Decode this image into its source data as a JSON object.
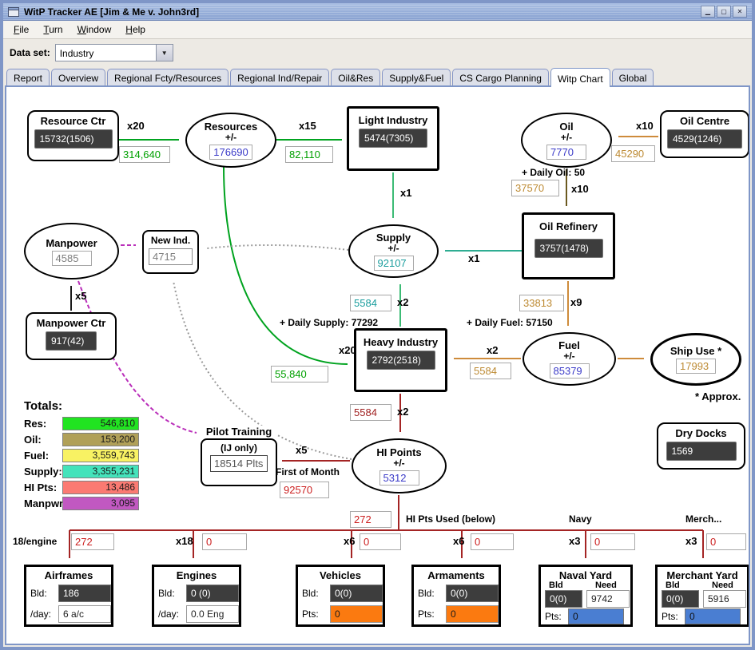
{
  "window": {
    "title": "WitP Tracker AE [Jim & Me v. John3rd]",
    "controls": {
      "minimize": "▁",
      "maximize": "▢",
      "close": "✕"
    }
  },
  "menu": {
    "items": [
      {
        "label": "File"
      },
      {
        "label": "Turn"
      },
      {
        "label": "Window"
      },
      {
        "label": "Help"
      }
    ]
  },
  "dataset": {
    "label": "Data set:",
    "value": "Industry"
  },
  "tabs": [
    {
      "label": "Report"
    },
    {
      "label": "Overview"
    },
    {
      "label": "Regional Fcty/Resources"
    },
    {
      "label": "Regional Ind/Repair"
    },
    {
      "label": "Oil&Res"
    },
    {
      "label": "Supply&Fuel"
    },
    {
      "label": "CS Cargo Planning"
    },
    {
      "label": "Witp Chart",
      "selected": true
    },
    {
      "label": "Global"
    }
  ],
  "nodes": {
    "resource_ctr": {
      "title": "Resource Ctr",
      "value": "15732(1506)"
    },
    "resources": {
      "title": "Resources",
      "pm": "+/-",
      "value": "176690"
    },
    "light_industry": {
      "title": "Light Industry",
      "value": "5474(7305)"
    },
    "oil": {
      "title": "Oil",
      "pm": "+/-",
      "value": "7770"
    },
    "oil_centre": {
      "title": "Oil Centre",
      "value": "4529(1246)"
    },
    "oil_refinery": {
      "title": "Oil Refinery",
      "value": "3757(1478)"
    },
    "supply": {
      "title": "Supply",
      "pm": "+/-",
      "value": "92107"
    },
    "manpower": {
      "title": "Manpower",
      "value": "4585"
    },
    "new_ind": {
      "title": "New Ind.",
      "value": "4715"
    },
    "manpower_ctr": {
      "title": "Manpower Ctr",
      "value": "917(42)"
    },
    "heavy_industry": {
      "title": "Heavy Industry",
      "value": "2792(2518)"
    },
    "fuel": {
      "title": "Fuel",
      "pm": "+/-",
      "value": "85379"
    },
    "ship_use": {
      "title": "Ship Use *",
      "value": "17993"
    },
    "pilot_training": {
      "title": "Pilot Training",
      "sub": "(IJ only)",
      "value": "18514 Plts"
    },
    "hi_points": {
      "title": "HI Points",
      "pm": "+/-",
      "value": "5312"
    },
    "dry_docks": {
      "title": "Dry Docks",
      "value": "1569"
    }
  },
  "flows": {
    "rc_to_resources": {
      "mult": "x20",
      "amount": "314,640"
    },
    "resources_to_light": {
      "mult": "x15",
      "amount": "82,110"
    },
    "resources_to_heavy": {
      "mult": "x20",
      "amount": "55,840"
    },
    "light_to_supply": {
      "mult": "x1"
    },
    "refinery_to_supply": {
      "mult": "x1"
    },
    "heavy_to_supply": {
      "mult": "x2",
      "amount": "5584"
    },
    "oilcentre_to_oil": {
      "mult": "x10",
      "amount": "45290"
    },
    "oil_to_refinery": {
      "mult": "x10",
      "amount": "37570"
    },
    "refinery_to_fuel": {
      "mult": "x9",
      "amount": "33813"
    },
    "fuel_to_heavy": {
      "mult": "x2",
      "amount": "5584"
    },
    "heavy_to_hipts": {
      "mult": "x2",
      "amount": "5584"
    },
    "hipts_to_pilot": {
      "mult": "x5"
    },
    "manpowerctr_to_manpower": {
      "mult": "x5"
    },
    "hipts_down": {
      "amount": "272"
    }
  },
  "annotations": {
    "daily_oil": "+ Daily Oil: 50",
    "daily_supply": "+ Daily Supply: 77292",
    "daily_fuel": "+ Daily Fuel: 57150",
    "approx": "* Approx.",
    "first_of_month": "First of Month",
    "first_of_month_amount": "92570",
    "hi_pts_used": "HI Pts Used (below)",
    "navy": "Navy",
    "merch": "Merch..."
  },
  "totals": {
    "heading": "Totals:",
    "rows": [
      {
        "label": "Res:",
        "value": "546,810",
        "color": "#21e421"
      },
      {
        "label": "Oil:",
        "value": "153,200",
        "color": "#b0a058"
      },
      {
        "label": "Fuel:",
        "value": "3,559,743",
        "color": "#f8f263"
      },
      {
        "label": "Supply:",
        "value": "3,355,231",
        "color": "#44e3bb"
      },
      {
        "label": "HI Pts:",
        "value": "13,486",
        "color": "#fb7a72"
      },
      {
        "label": "Manpwr:",
        "value": "3,095",
        "color": "#c158c1"
      }
    ]
  },
  "bottom_row": [
    {
      "label": "18/engine",
      "value": "272"
    },
    {
      "label": "x18",
      "value": "0"
    },
    {
      "label": "x6",
      "value": "0"
    },
    {
      "label": "x6",
      "value": "0"
    },
    {
      "label": "x3",
      "value": "0"
    },
    {
      "label": "x3",
      "value": "0"
    }
  ],
  "factories": [
    {
      "title": "Airframes",
      "row1_label": "Bld:",
      "row1_value": "186",
      "row2_label": "/day:",
      "row2_value": "6 a/c"
    },
    {
      "title": "Engines",
      "row1_label": "Bld:",
      "row1_value": "0 (0)",
      "row2_label": "/day:",
      "row2_value": "0.0 Eng"
    },
    {
      "title": "Vehicles",
      "row1_label": "Bld:",
      "row1_value": "0(0)",
      "row2_label": "Pts:",
      "row2_value": "0"
    },
    {
      "title": "Armaments",
      "row1_label": "Bld:",
      "row1_value": "0(0)",
      "row2_label": "Pts:",
      "row2_value": "0"
    },
    {
      "title": "Naval Yard",
      "bld_header": "Bld",
      "need_header": "Need",
      "bld": "0(0)",
      "need": "9742",
      "pts_label": "Pts:",
      "pts": "0"
    },
    {
      "title": "Merchant Yard",
      "bld_header": "Bld",
      "need_header": "Need",
      "bld": "0(0)",
      "need": "5916",
      "pts_label": "Pts:",
      "pts": "0"
    }
  ],
  "colors": {
    "pts_orange": "#fb7a10",
    "pts_blue": "#4a7ed2"
  }
}
